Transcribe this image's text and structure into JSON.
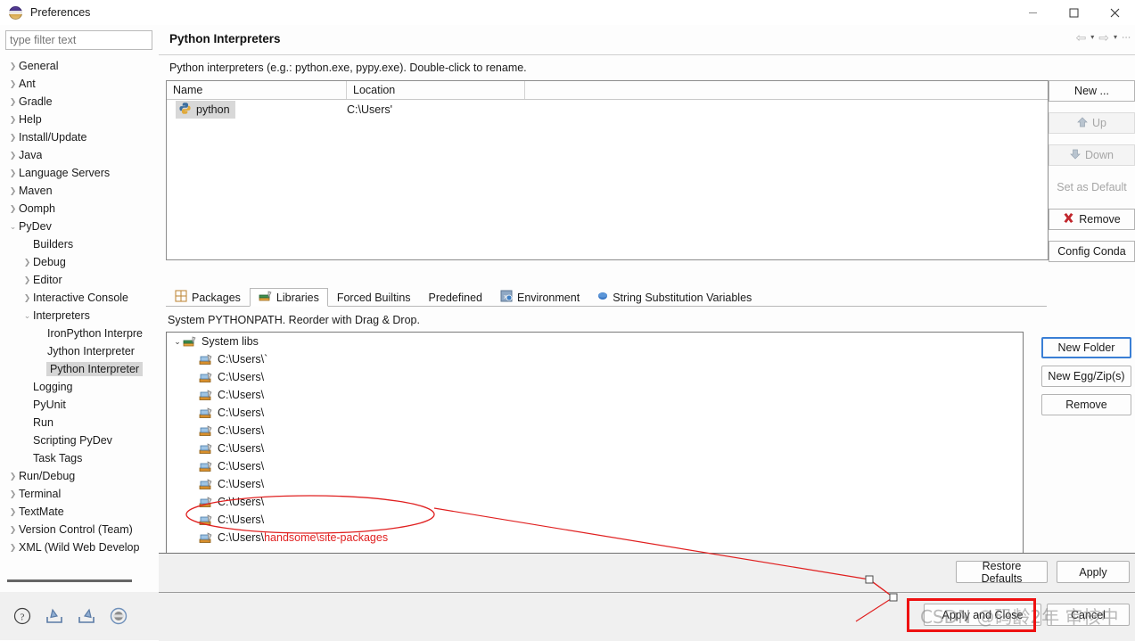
{
  "window": {
    "title": "Preferences",
    "minimize": "—",
    "maximize": "☐",
    "close": "✕"
  },
  "sidebar": {
    "filter_placeholder": "type filter text",
    "filter_value": "",
    "items": [
      {
        "label": "General",
        "depth": 0,
        "arrow": "collapsed"
      },
      {
        "label": "Ant",
        "depth": 0,
        "arrow": "collapsed"
      },
      {
        "label": "Gradle",
        "depth": 0,
        "arrow": "collapsed"
      },
      {
        "label": "Help",
        "depth": 0,
        "arrow": "collapsed"
      },
      {
        "label": "Install/Update",
        "depth": 0,
        "arrow": "collapsed"
      },
      {
        "label": "Java",
        "depth": 0,
        "arrow": "collapsed"
      },
      {
        "label": "Language Servers",
        "depth": 0,
        "arrow": "collapsed"
      },
      {
        "label": "Maven",
        "depth": 0,
        "arrow": "collapsed"
      },
      {
        "label": "Oomph",
        "depth": 0,
        "arrow": "collapsed"
      },
      {
        "label": "PyDev",
        "depth": 0,
        "arrow": "expanded"
      },
      {
        "label": "Builders",
        "depth": 1,
        "arrow": "none"
      },
      {
        "label": "Debug",
        "depth": 1,
        "arrow": "collapsed"
      },
      {
        "label": "Editor",
        "depth": 1,
        "arrow": "collapsed"
      },
      {
        "label": "Interactive Console",
        "depth": 1,
        "arrow": "collapsed"
      },
      {
        "label": "Interpreters",
        "depth": 1,
        "arrow": "expanded"
      },
      {
        "label": "IronPython Interpre",
        "depth": 2,
        "arrow": "none"
      },
      {
        "label": "Jython Interpreter",
        "depth": 2,
        "arrow": "none"
      },
      {
        "label": "Python Interpreter",
        "depth": 2,
        "arrow": "none",
        "selected": true
      },
      {
        "label": "Logging",
        "depth": 1,
        "arrow": "none"
      },
      {
        "label": "PyUnit",
        "depth": 1,
        "arrow": "none"
      },
      {
        "label": "Run",
        "depth": 1,
        "arrow": "none"
      },
      {
        "label": "Scripting PyDev",
        "depth": 1,
        "arrow": "none"
      },
      {
        "label": "Task Tags",
        "depth": 1,
        "arrow": "none"
      },
      {
        "label": "Run/Debug",
        "depth": 0,
        "arrow": "collapsed"
      },
      {
        "label": "Terminal",
        "depth": 0,
        "arrow": "collapsed"
      },
      {
        "label": "TextMate",
        "depth": 0,
        "arrow": "collapsed"
      },
      {
        "label": "Version Control (Team)",
        "depth": 0,
        "arrow": "collapsed"
      },
      {
        "label": "XML (Wild Web Develop",
        "depth": 0,
        "arrow": "collapsed"
      }
    ],
    "bottom_icons": [
      "help-icon",
      "import-icon",
      "export-icon",
      "oomph-record-icon"
    ]
  },
  "page": {
    "title": "Python Interpreters",
    "description": "Python interpreters (e.g.: python.exe, pypy.exe).   Double-click to rename.",
    "nav": {
      "back": "⇦",
      "back_caret": "▾",
      "forward": "⇨",
      "forward_caret": "▾",
      "menu": "⋮"
    }
  },
  "interpreter_table": {
    "columns": [
      "Name",
      "Location",
      ""
    ],
    "rows": [
      {
        "icon": "python-icon",
        "name": "python",
        "location": "C:\\Users'"
      }
    ]
  },
  "side_buttons": [
    {
      "label": "New ...",
      "state": "enabled",
      "icon": ""
    },
    {
      "label": "Up",
      "state": "disabled",
      "icon": "arrow-up-icon"
    },
    {
      "label": "Down",
      "state": "disabled",
      "icon": "arrow-down-icon"
    },
    {
      "label": "Set as Default",
      "state": "disabled",
      "icon": ""
    },
    {
      "label": "Remove",
      "state": "enabled",
      "icon": "remove-x-icon"
    },
    {
      "label": "Config Conda",
      "state": "enabled",
      "icon": ""
    }
  ],
  "tabs": [
    {
      "label": "Packages",
      "icon": "packages-icon",
      "active": false
    },
    {
      "label": "Libraries",
      "icon": "libraries-icon",
      "active": true
    },
    {
      "label": "Forced Builtins",
      "icon": "",
      "active": false
    },
    {
      "label": "Predefined",
      "icon": "",
      "active": false
    },
    {
      "label": "Environment",
      "icon": "environment-icon",
      "active": false
    },
    {
      "label": "String Substitution Variables",
      "icon": "blue-dot-icon",
      "active": false
    }
  ],
  "libraries": {
    "sub_description": "System PYTHONPATH.   Reorder with Drag & Drop.",
    "root": {
      "label": "System libs",
      "icon": "libs-stack-icon",
      "expanded": true
    },
    "entries": [
      {
        "prefix": "C:\\Users\\`",
        "highlight": ""
      },
      {
        "prefix": "C:\\Users\\",
        "highlight": ""
      },
      {
        "prefix": "C:\\Users\\",
        "highlight": ""
      },
      {
        "prefix": "C:\\Users\\",
        "highlight": ""
      },
      {
        "prefix": "C:\\Users\\",
        "highlight": ""
      },
      {
        "prefix": "C:\\Users\\",
        "highlight": ""
      },
      {
        "prefix": "C:\\Users\\",
        "highlight": ""
      },
      {
        "prefix": "C:\\Users\\",
        "highlight": ""
      },
      {
        "prefix": "C:\\Users\\",
        "highlight": ""
      },
      {
        "prefix": "C:\\Users\\",
        "highlight": ""
      },
      {
        "prefix": "C:\\Users\\",
        "highlight": "handsome\\site-packages"
      }
    ],
    "buttons": [
      {
        "label": "New Folder",
        "focused": true
      },
      {
        "label": "New Egg/Zip(s)",
        "focused": false
      },
      {
        "label": "Remove",
        "focused": false
      }
    ]
  },
  "footer": {
    "restore_defaults": "Restore Defaults",
    "apply": "Apply",
    "apply_and_close": "Apply and Close",
    "cancel": "Cancel"
  },
  "watermark": "CSDN @码龄2年 审核中",
  "annotation": {
    "color": "#e02020",
    "highlight_box_target": "apply-and-close-button"
  }
}
